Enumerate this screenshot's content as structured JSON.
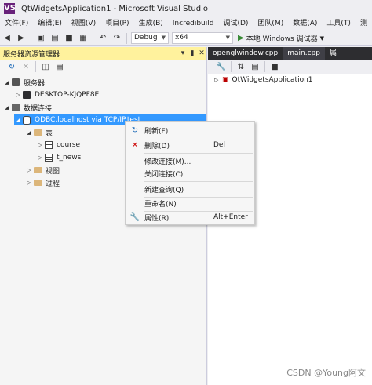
{
  "window": {
    "title": "QtWidgetsApplication1 - Microsoft Visual Studio",
    "logo": "VS"
  },
  "menubar": [
    "文件(F)",
    "编辑(E)",
    "视图(V)",
    "项目(P)",
    "生成(B)",
    "Incredibuild",
    "调试(D)",
    "团队(M)",
    "数据(A)",
    "工具(T)",
    "测"
  ],
  "toolbar": {
    "config": "Debug",
    "platform": "x64",
    "run_label": "本地 Windows 调试器"
  },
  "server_explorer": {
    "title": "服务器资源管理器",
    "pin_icon": "pin-icon",
    "close_icon": "close-icon",
    "tree": {
      "servers": "服务器",
      "machine": "DESKTOP-KJQPF8E",
      "data_connections": "数据连接",
      "connection": "ODBC.localhost via TCP/IP.test",
      "tables": "表",
      "table1": "course",
      "table2": "t_news",
      "views": "视图",
      "procedures": "过程"
    }
  },
  "doc_tabs": [
    "openglwindow.cpp",
    "main.cpp",
    "属"
  ],
  "solution": {
    "project": "QtWidgetsApplication1"
  },
  "context_menu": {
    "refresh": {
      "label": "刷新(F)",
      "icon": "refresh-icon"
    },
    "delete": {
      "label": "删除(D)",
      "shortcut": "Del",
      "icon": "delete-icon"
    },
    "modify": {
      "label": "修改连接(M)..."
    },
    "close": {
      "label": "关闭连接(C)"
    },
    "new_query": {
      "label": "新建查询(Q)"
    },
    "rename": {
      "label": "重命名(N)"
    },
    "properties": {
      "label": "属性(R)",
      "shortcut": "Alt+Enter",
      "icon": "wrench-icon"
    }
  },
  "watermark": "CSDN @Young阿文"
}
